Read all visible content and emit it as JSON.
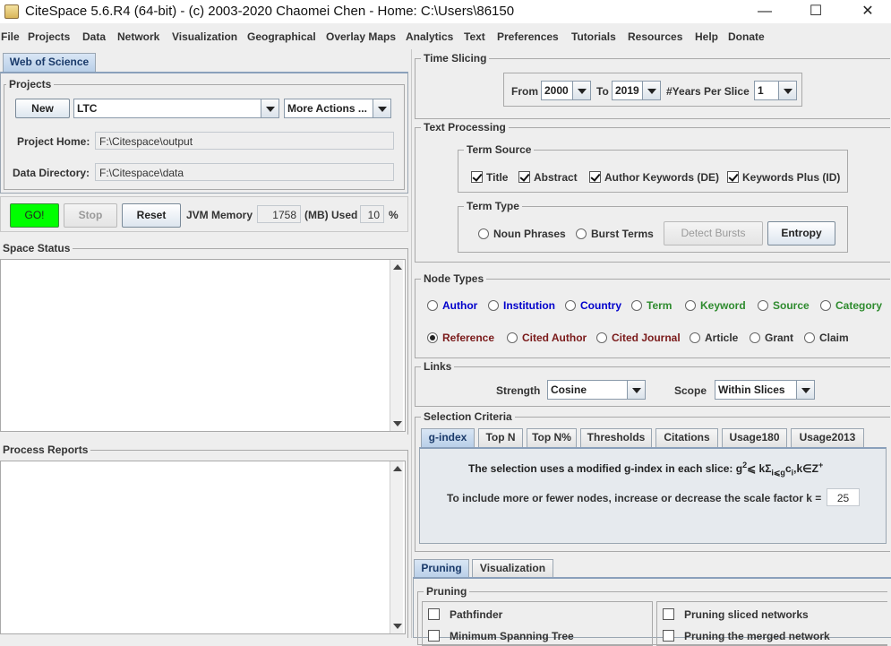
{
  "window": {
    "title": "CiteSpace 5.6.R4 (64-bit) - (c) 2003-2020 Chaomei Chen - Home: C:\\Users\\86150",
    "minimize_glyph": "—",
    "maximize_glyph": "☐",
    "close_glyph": "✕"
  },
  "menu": [
    "File",
    "Projects",
    "Data",
    "Network",
    "Visualization",
    "Geographical",
    "Overlay Maps",
    "Analytics",
    "Text",
    "Preferences",
    "Tutorials",
    "Resources",
    "Help",
    "Donate"
  ],
  "left": {
    "source_tab": "Web of Science",
    "projects": {
      "title": "Projects",
      "new_label": "New",
      "project_value": "LTC",
      "more_actions_label": "More Actions ...",
      "home_label": "Project Home:",
      "home_value": "F:\\Citespace\\output",
      "data_label": "Data Directory:",
      "data_value": "F:\\Citespace\\data"
    },
    "controls": {
      "go_label": "GO!",
      "stop_label": "Stop",
      "reset_label": "Reset",
      "jvm_label": "JVM Memory",
      "jvm_value": "1758",
      "used_label": "(MB) Used",
      "used_value": "10",
      "pct_label": "%"
    },
    "space_status_title": "Space Status",
    "process_reports_title": "Process Reports"
  },
  "time_slicing": {
    "title": "Time Slicing",
    "from_label": "From",
    "from_value": "2000",
    "to_label": "To",
    "to_value": "2019",
    "years_label": "#Years Per Slice",
    "years_value": "1"
  },
  "text_processing": {
    "title": "Text Processing",
    "term_source_title": "Term Source",
    "term_source": [
      {
        "label": "Title",
        "checked": true
      },
      {
        "label": "Abstract",
        "checked": true
      },
      {
        "label": "Author Keywords (DE)",
        "checked": true
      },
      {
        "label": "Keywords Plus (ID)",
        "checked": true
      }
    ],
    "term_type_title": "Term Type",
    "noun_phrases_label": "Noun Phrases",
    "burst_terms_label": "Burst Terms",
    "detect_bursts_label": "Detect Bursts",
    "entropy_label": "Entropy"
  },
  "node_types": {
    "title": "Node Types",
    "row1": [
      {
        "label": "Author",
        "color": "#0000cc"
      },
      {
        "label": "Institution",
        "color": "#0000cc"
      },
      {
        "label": "Country",
        "color": "#0000cc"
      },
      {
        "label": "Term",
        "color": "#2e8b2e"
      },
      {
        "label": "Keyword",
        "color": "#2e8b2e"
      },
      {
        "label": "Source",
        "color": "#2e8b2e"
      },
      {
        "label": "Category",
        "color": "#2e8b2e"
      }
    ],
    "row2": [
      {
        "label": "Reference",
        "color": "#7a1a1a",
        "checked": true
      },
      {
        "label": "Cited Author",
        "color": "#7a1a1a"
      },
      {
        "label": "Cited Journal",
        "color": "#7a1a1a"
      },
      {
        "label": "Article",
        "color": "#333333"
      },
      {
        "label": "Grant",
        "color": "#333333"
      },
      {
        "label": "Claim",
        "color": "#333333"
      }
    ]
  },
  "links": {
    "title": "Links",
    "strength_label": "Strength",
    "strength_value": "Cosine",
    "scope_label": "Scope",
    "scope_value": "Within Slices"
  },
  "selection": {
    "title": "Selection Criteria",
    "tabs": [
      "g-index",
      "Top N",
      "Top N%",
      "Thresholds",
      "Citations",
      "Usage180",
      "Usage2013"
    ],
    "line1": "The selection uses a modified g-index in each slice: ",
    "formula_g": "g",
    "formula_sup2": "2",
    "formula_mid": "⩽ kΣ",
    "formula_sub": "i⩽g",
    "formula_c": "c",
    "formula_sub_i": "i",
    "formula_end": ",k∈Z",
    "formula_plus": "+",
    "line2": "To include more or fewer nodes, increase or decrease the scale factor k =",
    "k_value": "25"
  },
  "bottom": {
    "tabs": [
      "Pruning",
      "Visualization"
    ],
    "pruning_title": "Pruning",
    "left_items": [
      "Pathfinder",
      "Minimum Spanning Tree"
    ],
    "right_items": [
      "Pruning sliced networks",
      "Pruning the merged network"
    ]
  }
}
